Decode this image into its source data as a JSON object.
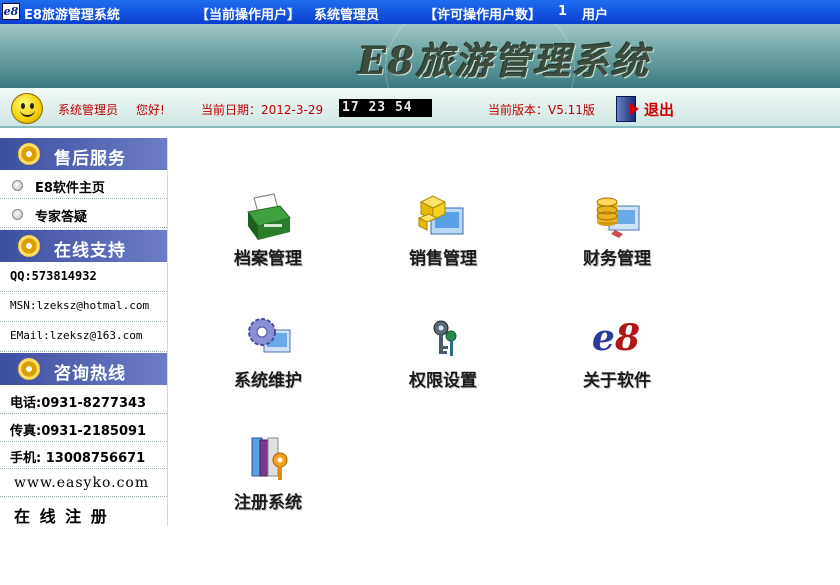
{
  "titlebar": {
    "logo": "e8",
    "app_title": "E8旅游管理系统",
    "current_user_label": "【当前操作用户】",
    "current_user": "系统管理员",
    "license_label": "【许可操作用户数】",
    "license_count": "1",
    "license_unit": "用户"
  },
  "banner": {
    "title": "E8旅游管理系统"
  },
  "infobar": {
    "user": "系统管理员",
    "greeting": "您好!",
    "date_label": "当前日期：2012-3-29",
    "clock": "17 23 54",
    "version_label": "当前版本：V5.11版",
    "exit_label": "退出"
  },
  "sidebar": {
    "after_sales": {
      "title": "售后服务",
      "items": [
        "E8软件主页",
        "专家答疑"
      ]
    },
    "online_support": {
      "title": "在线支持",
      "items": [
        "QQ:573814932",
        "MSN:lzeksz@hotmal.com",
        "EMail:lzeksz@163.com"
      ]
    },
    "hotline": {
      "title": "咨询热线",
      "items": [
        "电话:0931-8277343",
        "传真:0931-2185091",
        "手机: 13008756671",
        "www.easyko.com",
        "在 线 注 册"
      ]
    }
  },
  "modules": [
    {
      "label": "档案管理",
      "icon": "archive-printer-icon"
    },
    {
      "label": "销售管理",
      "icon": "sales-boxes-icon"
    },
    {
      "label": "财务管理",
      "icon": "finance-coins-icon"
    },
    {
      "label": "系统维护",
      "icon": "gear-monitor-icon"
    },
    {
      "label": "权限设置",
      "icon": "keys-icon"
    },
    {
      "label": "关于软件",
      "icon": "e8-logo-icon"
    },
    {
      "label": "注册系统",
      "icon": "books-key-icon"
    }
  ],
  "colors": {
    "titlebar": "#0a3fd0",
    "sidebar_header": "#4a5aaa",
    "accent_red": "#c00000"
  }
}
